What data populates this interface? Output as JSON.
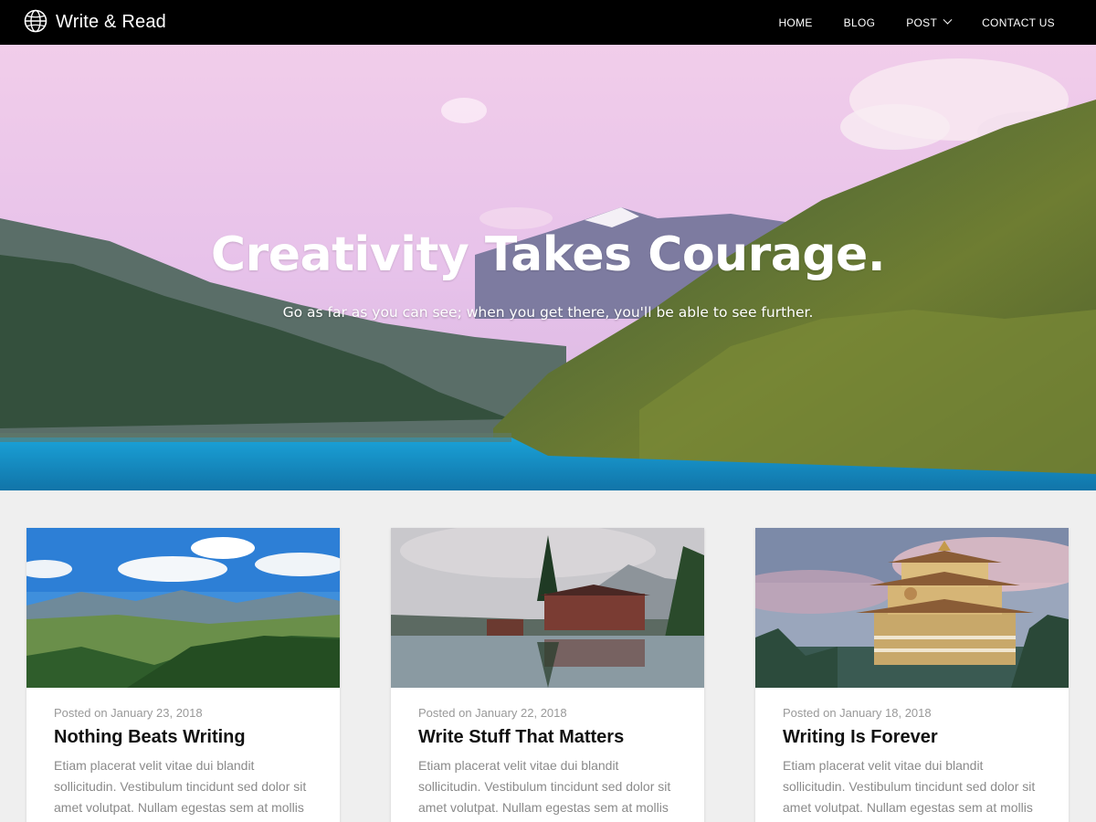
{
  "nav": {
    "brand": "Write & Read",
    "brand_icon": "globe-icon",
    "links": [
      {
        "label": "HOME"
      },
      {
        "label": "BLOG"
      },
      {
        "label": "POST",
        "dropdown": true
      },
      {
        "label": "CONTACT US"
      }
    ]
  },
  "hero": {
    "title": "Creativity Takes Courage.",
    "subtitle": "Go as far as you can see; when you get there, you'll be able to see further."
  },
  "posts": [
    {
      "date": "Posted on January 23, 2018",
      "title": "Nothing Beats Writing",
      "excerpt": "Etiam placerat velit vitae dui blandit sollicitudin. Vestibulum tincidunt sed dolor sit amet volutpat. Nullam egestas sem at mollis"
    },
    {
      "date": "Posted on January 22, 2018",
      "title": "Write Stuff That Matters",
      "excerpt": "Etiam placerat velit vitae dui blandit sollicitudin. Vestibulum tincidunt sed dolor sit amet volutpat. Nullam egestas sem at mollis"
    },
    {
      "date": "Posted on January 18, 2018",
      "title": "Writing Is Forever",
      "excerpt": "Etiam placerat velit vitae dui blandit sollicitudin. Vestibulum tincidunt sed dolor sit amet volutpat. Nullam egestas sem at mollis"
    }
  ],
  "colors": {
    "nav_bg": "#000000",
    "page_bg": "#efefef",
    "card_bg": "#ffffff",
    "meta_text": "#999999",
    "title_text": "#111111"
  }
}
